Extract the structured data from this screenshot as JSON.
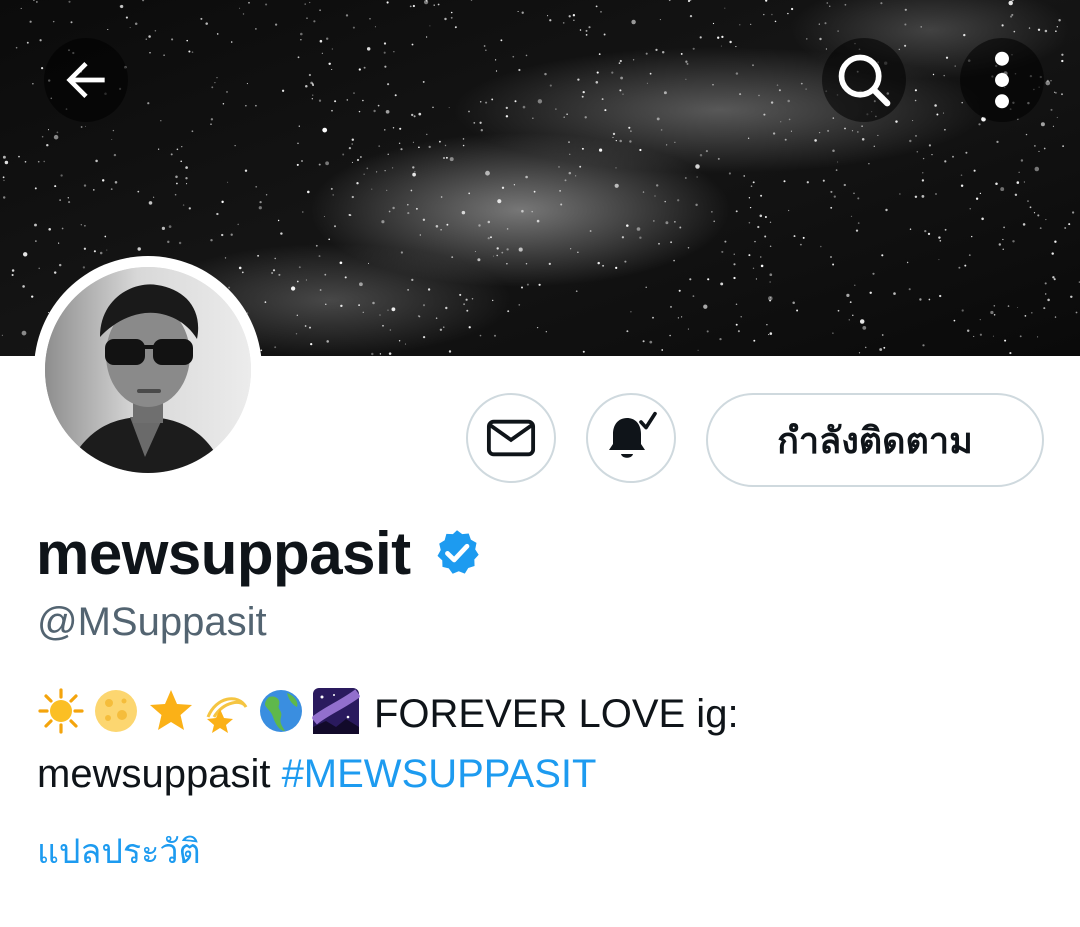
{
  "header": {
    "back_icon": "arrow-left-icon",
    "search_icon": "search-icon",
    "more_icon": "more-vertical-icon"
  },
  "profile": {
    "display_name": "mewsuppasit",
    "verified_badge": "verified-badge-icon",
    "handle": "@MSuppasit",
    "bio_emojis": [
      "sun-icon",
      "full-moon-icon",
      "star-icon",
      "dizzy-star-icon",
      "globe-americas-icon",
      "milky-way-icon"
    ],
    "bio_text": "FOREVER LOVE ig:",
    "bio_text_line2": "mewsuppasit",
    "bio_hashtag": "#MEWSUPPASIT",
    "translate_link": "แปลประวัติ"
  },
  "actions": {
    "message_icon": "mail-icon",
    "notifications_icon": "bell-check-icon",
    "follow_label": "กำลังติดตาม"
  },
  "colors": {
    "accent": "#1d9bf0",
    "text_primary": "#0f1419",
    "text_secondary": "#536471",
    "button_border": "#cfd9de"
  }
}
